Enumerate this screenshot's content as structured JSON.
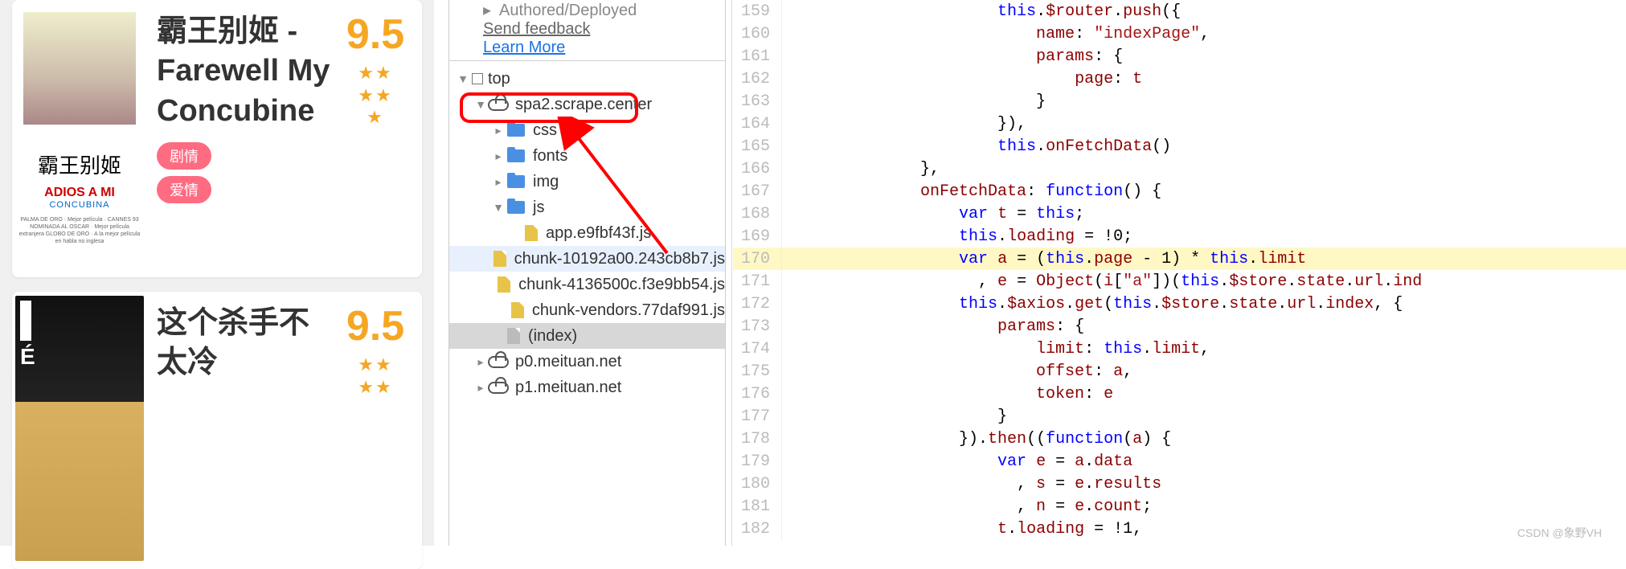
{
  "movies": [
    {
      "title": "霸王别姬 - Farewell My Concubine",
      "rating": "9.5",
      "tags": [
        "剧情",
        "爱情"
      ],
      "poster": {
        "cn": "霸王别姬",
        "en1": "ADIOS A MI",
        "en2": "CONCUBINA",
        "foot": "PALMA DE ORO · Mejor película · CANNES 93\nNOMINADA AL OSCAR · Mejor película extranjera\nGLOBO DE ORO · A la mejor película en habla no inglesa"
      }
    },
    {
      "title": "这个杀手不太冷",
      "rating": "9.5",
      "tags": []
    }
  ],
  "sources": {
    "info1": "Authored/Deployed",
    "feedback": "Send feedback",
    "learn": "Learn More",
    "tree": {
      "top": "top",
      "domain": "spa2.scrape.center",
      "folders": [
        "css",
        "fonts",
        "img",
        "js"
      ],
      "jsfiles": [
        "app.e9fbf43f.js",
        "chunk-10192a00.243cb8b7.js",
        "chunk-4136500c.f3e9bb54.js",
        "chunk-vendors.77daf991.js"
      ],
      "index": "(index)",
      "ext1": "p0.meituan.net",
      "ext2": "p1.meituan.net"
    }
  },
  "code": {
    "start": 159,
    "hl": 170,
    "lines": [
      "                    this.$router.push({",
      "                        name: \"indexPage\",",
      "                        params: {",
      "                            page: t",
      "                        }",
      "                    }),",
      "                    this.onFetchData()",
      "            },",
      "            onFetchData: function() {",
      "                var t = this;",
      "                this.loading = !0;",
      "                var a = (this.page - 1) * this.limit",
      "                  , e = Object(i[\"a\"])(this.$store.state.url.ind",
      "                this.$axios.get(this.$store.state.url.index, {",
      "                    params: {",
      "                        limit: this.limit,",
      "                        offset: a,",
      "                        token: e",
      "                    }",
      "                }).then((function(a) {",
      "                    var e = a.data",
      "                      , s = e.results",
      "                      , n = e.count;",
      "                    t.loading = !1,"
    ]
  },
  "watermark": "CSDN @象野VH"
}
